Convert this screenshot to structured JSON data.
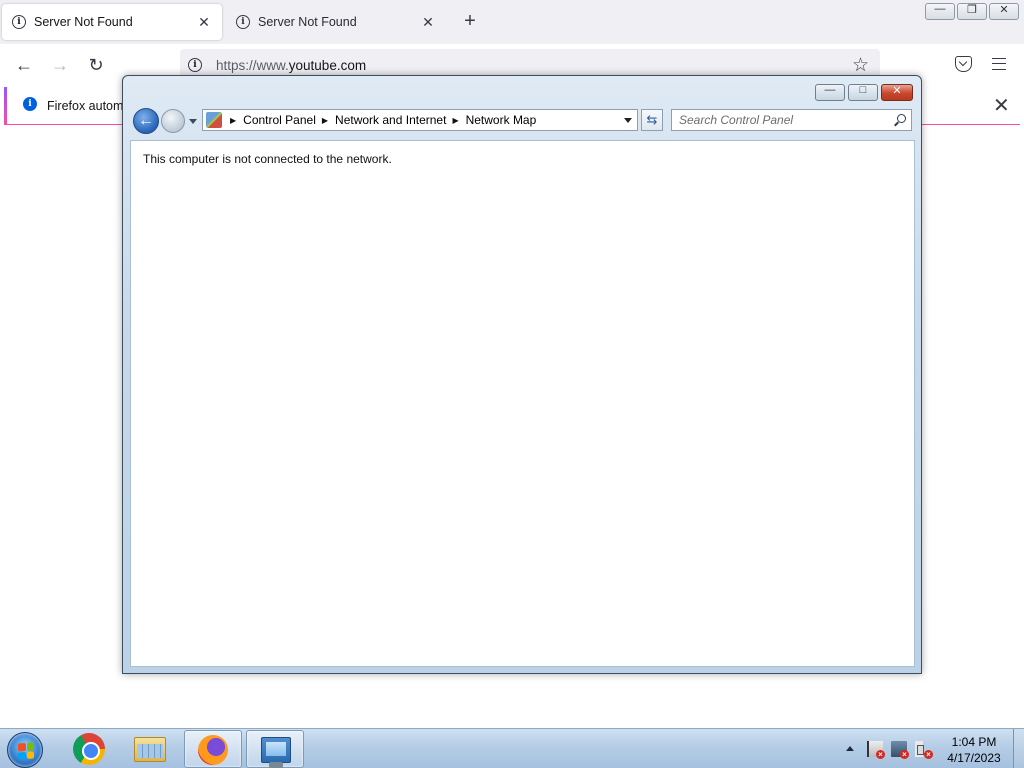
{
  "firefox": {
    "tabs": [
      {
        "title": "Server Not Found",
        "active": true
      },
      {
        "title": "Server Not Found",
        "active": false
      }
    ],
    "new_tab_label": "+",
    "url": {
      "scheme_prefix": "https://www.",
      "host": "youtube.com"
    },
    "notification": {
      "text": "Firefox automa"
    },
    "window_controls": {
      "minimize": "—",
      "restore": "❐",
      "close": "✕"
    }
  },
  "control_panel": {
    "breadcrumb": [
      "Control Panel",
      "Network and Internet",
      "Network Map"
    ],
    "search_placeholder": "Search Control Panel",
    "message": "This computer is not connected to the network.",
    "window_controls": {
      "minimize": "—",
      "maximize": "□",
      "close": "✕"
    }
  },
  "taskbar": {
    "items": [
      "start-orb",
      "chrome-icon",
      "file-explorer-icon",
      "firefox-icon",
      "network-map-icon"
    ],
    "tray_icons": [
      "action-center-flag-icon",
      "network-disconnected-icon",
      "volume-muted-icon"
    ],
    "clock": {
      "time": "1:04 PM",
      "date": "4/17/2023"
    }
  },
  "colors": {
    "taskbar": "#b5cde6",
    "aero_frame": "#c7d9ea",
    "firefox_chrome": "#f0f0f4"
  }
}
